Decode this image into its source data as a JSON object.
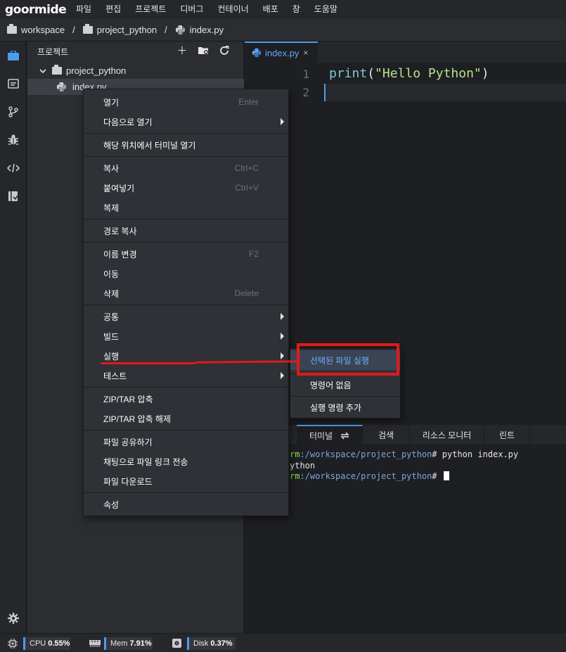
{
  "app": {
    "logo": "goormide"
  },
  "menubar": {
    "items": [
      "파일",
      "편집",
      "프로젝트",
      "디버그",
      "컨테이너",
      "배포",
      "창",
      "도움말"
    ]
  },
  "breadcrumb": {
    "items": [
      "workspace",
      "project_python",
      "index.py"
    ],
    "separator": "/"
  },
  "project_panel": {
    "title": "프로젝트",
    "tree": {
      "folder": "project_python",
      "file": "index.py"
    }
  },
  "editor": {
    "tab_label": "index.py",
    "tab_close": "×",
    "line_numbers": [
      "1",
      "2"
    ],
    "code": {
      "fn": "print",
      "open": "(",
      "str": "\"Hello Python\"",
      "close": ")"
    }
  },
  "context_menu": {
    "open": "열기",
    "open_shortcut": "Enter",
    "open_with": "다음으로 열기",
    "terminal_here": "해당 위치에서 터미널 열기",
    "copy": "복사",
    "copy_shortcut": "Ctrl+C",
    "paste": "붙여넣기",
    "paste_shortcut": "Ctrl+V",
    "duplicate": "복제",
    "copy_path": "경로 복사",
    "rename": "이름 변경",
    "rename_shortcut": "F2",
    "move": "이동",
    "delete": "삭제",
    "delete_shortcut": "Delete",
    "common": "공통",
    "build": "빌드",
    "run": "실행",
    "test": "테스트",
    "zip": "ZIP/TAR 압축",
    "unzip": "ZIP/TAR 압축 해제",
    "share": "파일 공유하기",
    "send_link": "채팅으로 파일 링크 전송",
    "download": "파일 다운로드",
    "properties": "속성"
  },
  "submenu": {
    "run_selected": "선택된 파일 실행",
    "no_command": "명령어 없음",
    "add_command": "실행 명령 추가"
  },
  "terminal": {
    "tabs": [
      "터미널",
      "검색",
      "리소스 모니터",
      "린트"
    ],
    "lines": [
      {
        "user": "rm",
        "path": ":/workspace/project_python",
        "rest": "# python index.py"
      },
      {
        "text": "ython"
      },
      {
        "user": "rm",
        "path": ":/workspace/project_python",
        "rest": "# "
      }
    ]
  },
  "status": {
    "cpu_label": "CPU",
    "cpu_value": "0.55%",
    "mem_label": "Mem",
    "mem_value": "7.91%",
    "disk_label": "Disk",
    "disk_value": "0.37%"
  },
  "colors": {
    "accent": "#4d9cf0",
    "annotation": "#e01a1a",
    "terminal_user": "#8ee04f",
    "terminal_path": "#7aa6da"
  }
}
